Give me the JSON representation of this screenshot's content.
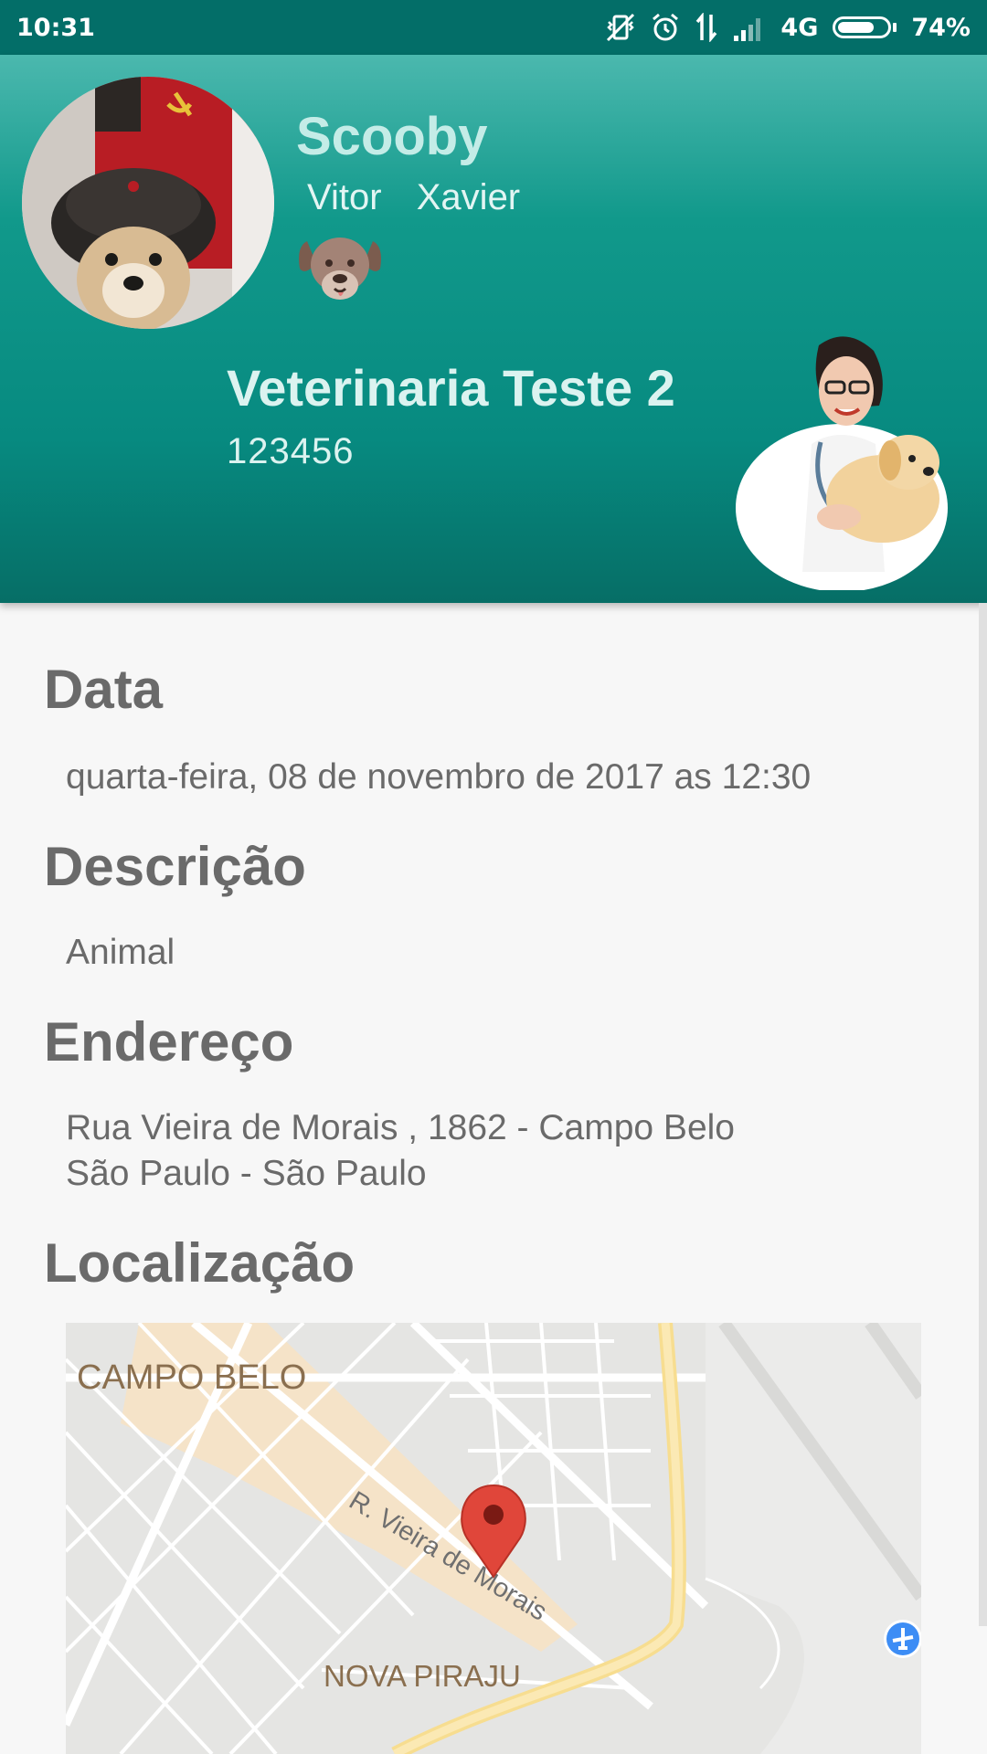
{
  "status_bar": {
    "time": "10:31",
    "network": "4G",
    "battery_percent": "74%",
    "battery_level": 0.74,
    "icons": [
      "vibrate-off-icon",
      "alarm-icon",
      "data-arrows-icon",
      "signal-icon",
      "battery-icon"
    ]
  },
  "header": {
    "pet_name": "Scooby",
    "owner_name": "Vitor  Xavier",
    "pet_type_icon": "dog-face-icon",
    "vet_name": "Veterinaria Teste 2",
    "vet_id": "123456"
  },
  "details": {
    "date_title": "Data",
    "date_value": "quarta-feira, 08 de novembro de 2017 as 12:30",
    "description_title": "Descrição",
    "description_value": "Animal",
    "address_title": "Endereço",
    "address_line1": "Rua Vieira de Morais , 1862 - Campo Belo",
    "address_line2": "São Paulo - São Paulo",
    "location_title": "Localização"
  },
  "map": {
    "labels": {
      "neighborhood_1": "CAMPO BELO",
      "street": "R. Vieira de Morais",
      "neighborhood_2": "NOVA PIRAJU"
    },
    "marker_icon": "map-pin-icon",
    "airport_icon": "airport-icon",
    "colors": {
      "background": "#e5e5e3",
      "road": "#ffffff",
      "highway": "#fbe4a4",
      "commercial": "#f6e3c8",
      "marker": "#e0463a"
    }
  },
  "colors": {
    "primary_dark": "#036e68",
    "primary": "#11998b"
  }
}
